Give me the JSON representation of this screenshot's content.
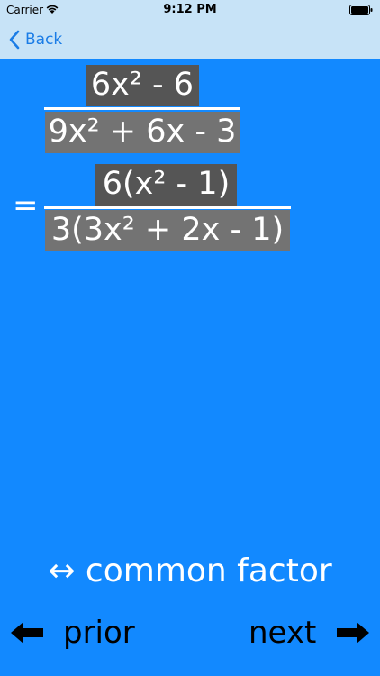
{
  "status_bar": {
    "carrier": "Carrier",
    "time": "9:12 PM",
    "wifi_icon": "wifi-icon",
    "battery_icon": "battery-icon"
  },
  "nav_bar": {
    "back_label": "Back",
    "back_icon": "chevron-left-icon",
    "accent_color": "#1a7ce6",
    "background_color": "#c7e3f7"
  },
  "expression": {
    "original": {
      "numerator": "6x² - 6",
      "denominator": "9x² + 6x - 3"
    },
    "equals": "=",
    "factored": {
      "numerator": "6(x² - 1)",
      "denominator": "3(3x² + 2x - 1)"
    }
  },
  "hint": {
    "text": "↔ common factor"
  },
  "navigation": {
    "prior_label": "prior",
    "next_label": "next",
    "prior_icon": "arrow-left-icon",
    "next_icon": "arrow-right-icon"
  },
  "colors": {
    "background": "#1289ff",
    "dark_box": "#555555",
    "gray_box": "#737373",
    "text": "#ffffff"
  }
}
